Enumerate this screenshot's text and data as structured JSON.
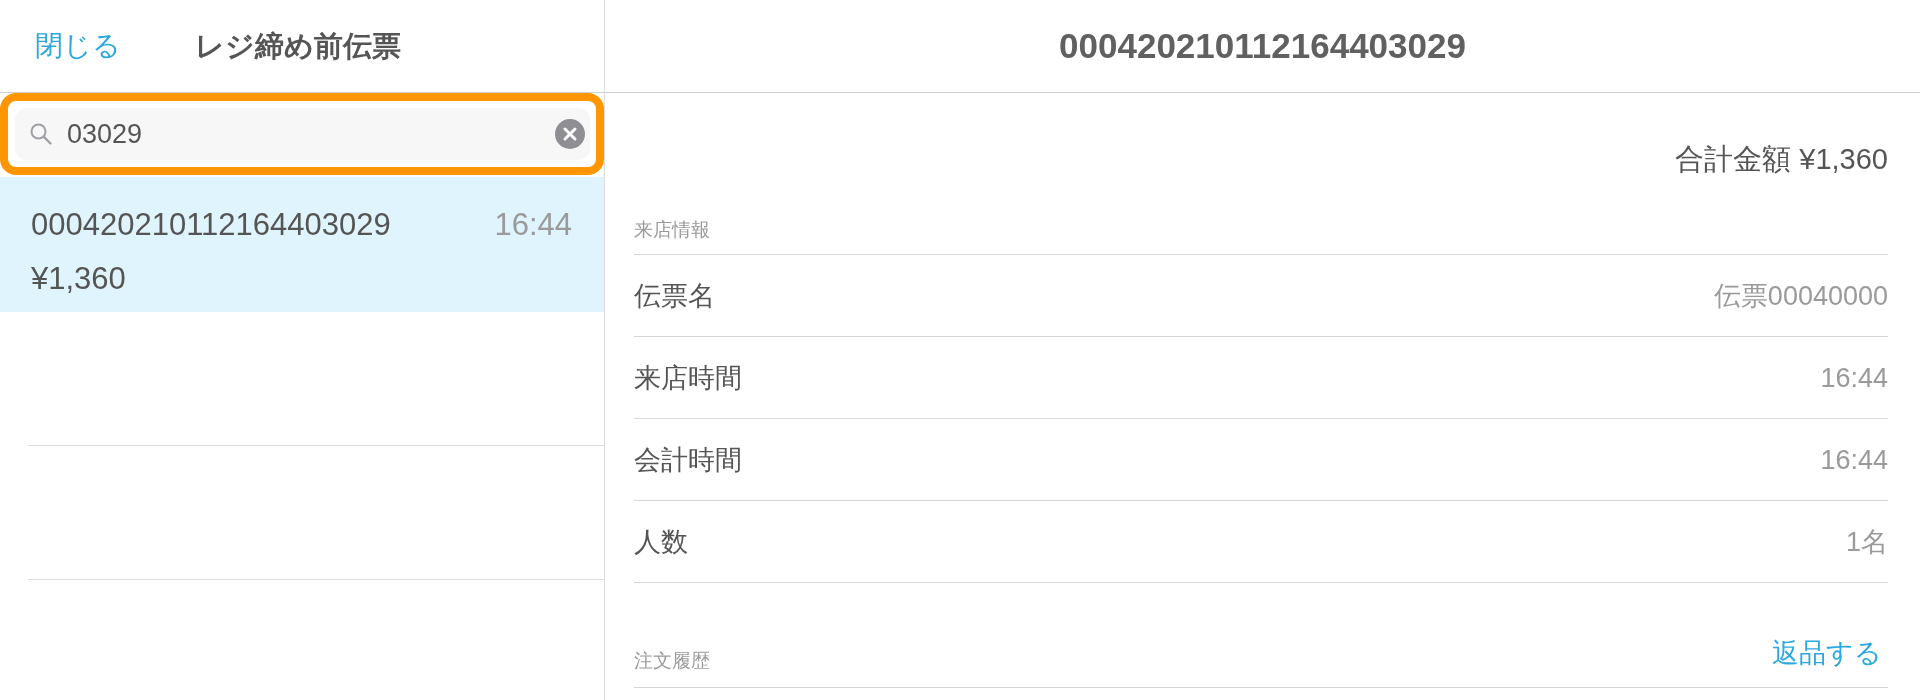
{
  "sidebar": {
    "close_button": "閉じる",
    "title": "レジ締め前伝票",
    "search": {
      "value": "03029",
      "highlighted": true
    },
    "receipts": [
      {
        "number": "000420210112164403029",
        "time": "16:44",
        "amount": "¥1,360",
        "selected": true
      }
    ]
  },
  "detail": {
    "title": "000420210112164403029",
    "total": "合計金額 ¥1,360",
    "sections": [
      {
        "label": "来店情報",
        "rows": [
          {
            "label": "伝票名",
            "value": "伝票00040000"
          },
          {
            "label": "来店時間",
            "value": "16:44"
          },
          {
            "label": "会計時間",
            "value": "16:44"
          },
          {
            "label": "人数",
            "value": "1名"
          }
        ]
      },
      {
        "label": "注文履歴",
        "action": "返品する"
      }
    ]
  }
}
